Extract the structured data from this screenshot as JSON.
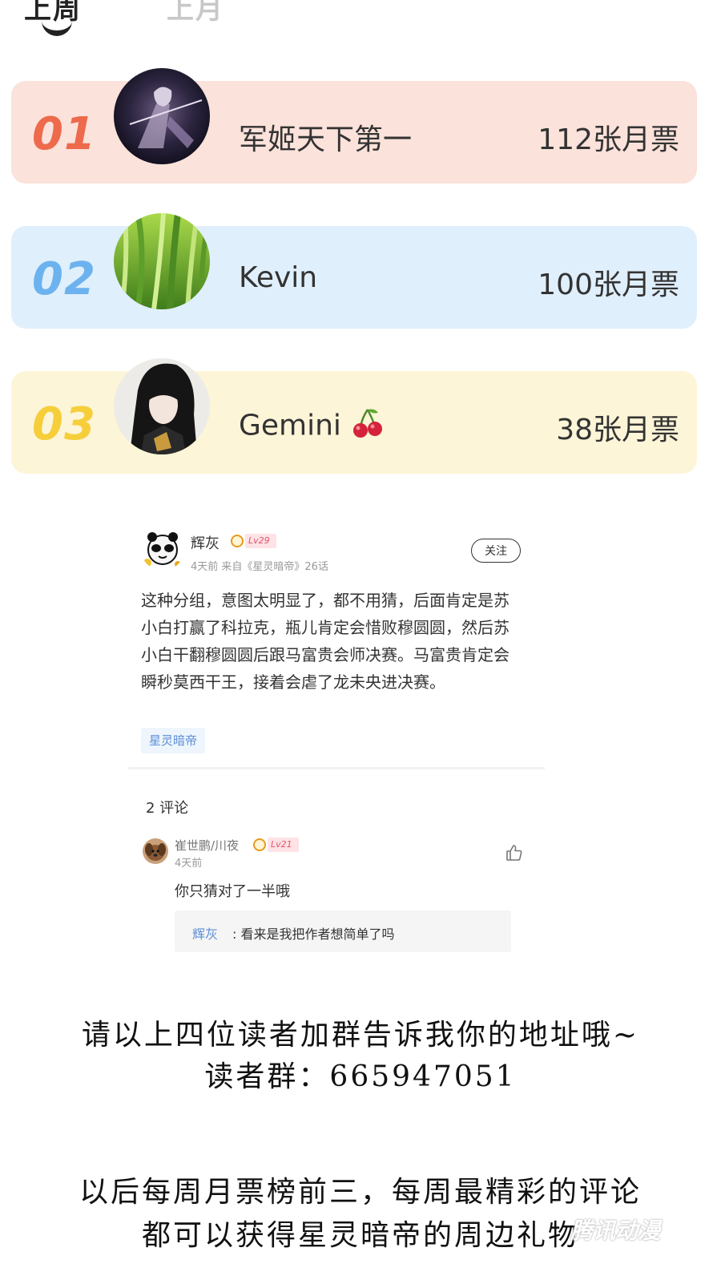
{
  "tabs": {
    "active": "上周",
    "inactive": "上月"
  },
  "ranking": [
    {
      "rank": "01",
      "name": "军姬天下第一",
      "votes": "112张月票",
      "bg": "#fbe2da",
      "rank_color": "#ee6a4c"
    },
    {
      "rank": "02",
      "name": "Kevin",
      "votes": "100张月票",
      "bg": "#e0effc",
      "rank_color": "#6cb2ef"
    },
    {
      "rank": "03",
      "name": "Gemini",
      "name_icon": "cherry-icon",
      "votes": "38张月票",
      "bg": "#fcf5d8",
      "rank_color": "#f6ce3a"
    }
  ],
  "comment": {
    "user": "辉灰",
    "level": "Lv29",
    "meta": "4天前 来自《星灵暗帝》26话",
    "follow": "关注",
    "body": "这种分组，意图太明显了，都不用猜，后面肯定是苏小白打赢了科拉克，瓶儿肯定会惜败穆圆圆，然后苏小白干翻穆圆圆后跟马富贵会师决赛。马富贵肯定会瞬秒莫西干王，接着会虐了龙未央进决赛。",
    "tag": "星灵暗帝"
  },
  "replies": {
    "count_label": "2 评论",
    "items": [
      {
        "user": "崔世鹏/川夜",
        "level": "Lv21",
        "time": "4天前",
        "body": "你只猜对了一半哦",
        "sub_reply": {
          "user": "辉灰",
          "text": ": 看来是我把作者想简单了吗"
        }
      }
    ]
  },
  "handwritten": {
    "line1": "请以上四位读者加群告诉我你的地址哦~",
    "line2": "读者群：665947051",
    "line3": "以后每周月票榜前三，每周最精彩的评论",
    "line4": "都可以获得星灵暗帝的周边礼物"
  },
  "watermark": "腾讯动漫"
}
